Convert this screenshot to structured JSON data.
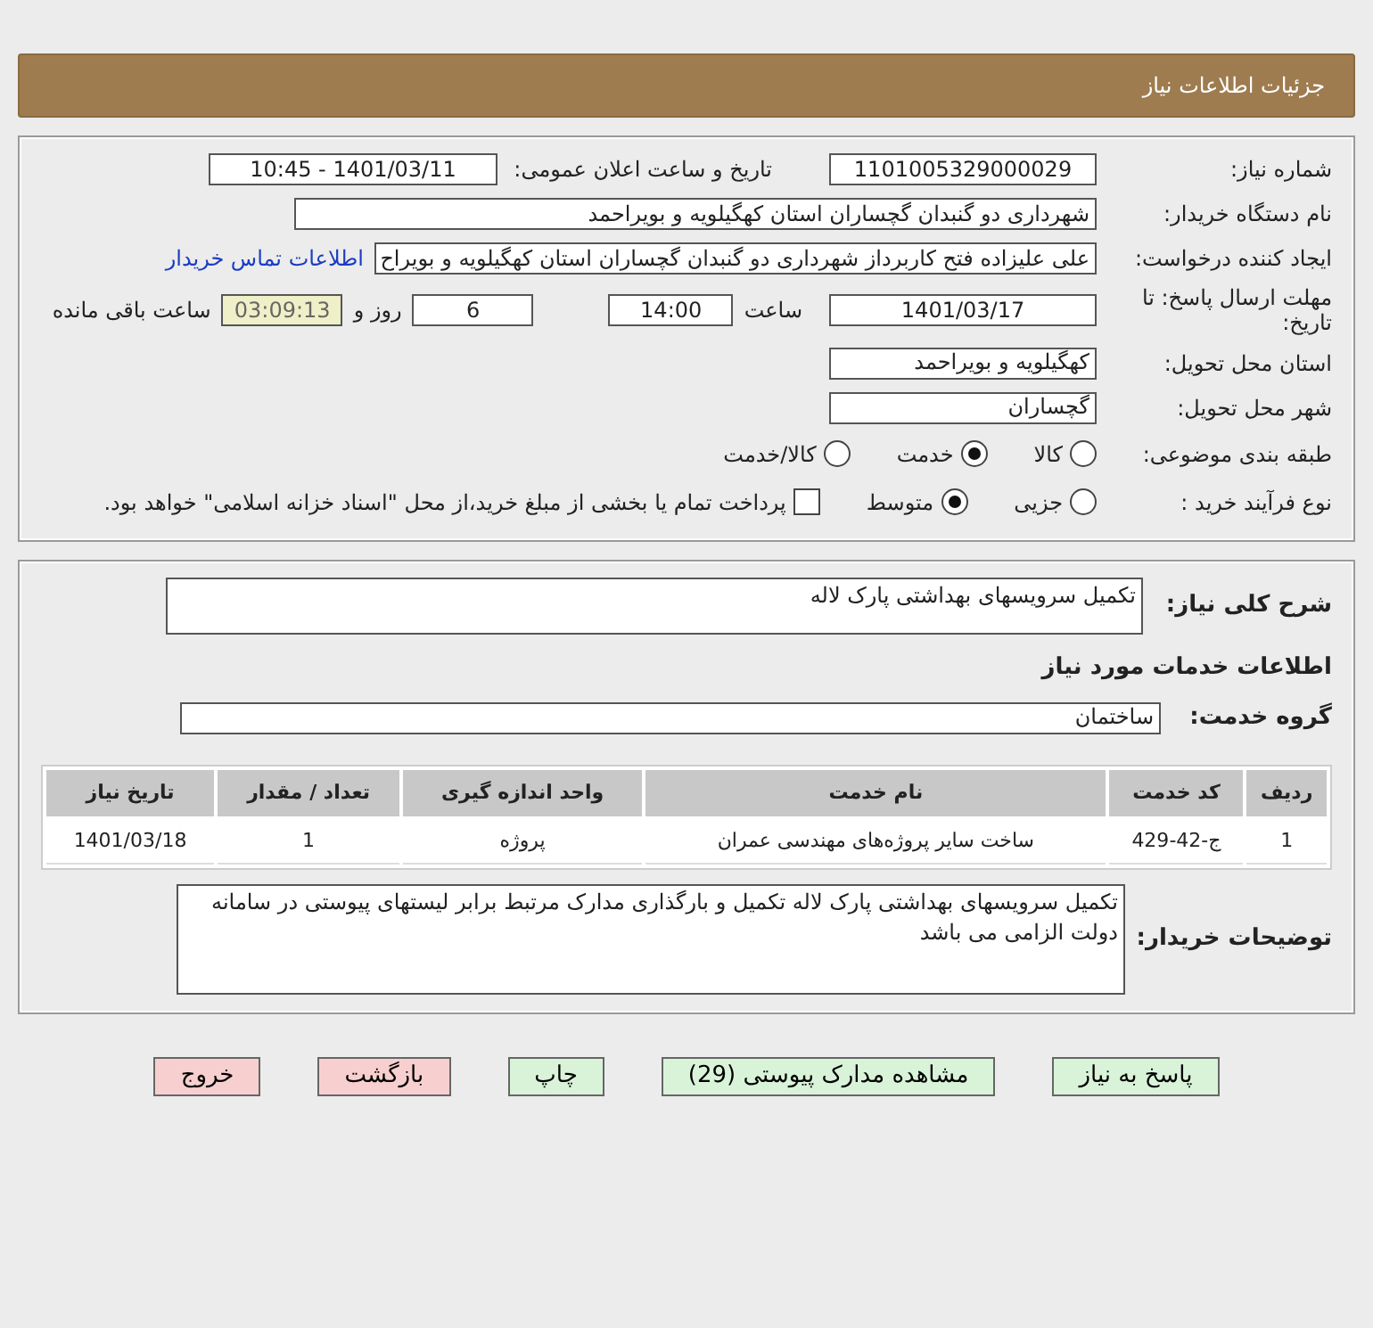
{
  "header": {
    "title": "جزئیات اطلاعات نیاز"
  },
  "need_number": {
    "label": "شماره نیاز:",
    "value": "1101005329000029"
  },
  "announce": {
    "label": "تاریخ و ساعت اعلان عمومی:",
    "value": "1401/03/11 - 10:45"
  },
  "buyer_org": {
    "label": "نام دستگاه خریدار:",
    "value": "شهرداری دو گنبدان گچساران استان کهگیلویه و بویراحمد"
  },
  "requester": {
    "label": "ایجاد کننده درخواست:",
    "value": "علی علیزاده فتح کاربرداز شهرداری دو گنبدان گچساران استان کهگیلویه و بویراح",
    "link": "اطلاعات تماس خریدار"
  },
  "deadline": {
    "label": "مهلت ارسال پاسخ: تا تاریخ:",
    "date": "1401/03/17",
    "time_label": "ساعت",
    "time": "14:00",
    "days": "6",
    "days_label": "روز و",
    "remaining": "03:09:13",
    "remaining_label": "ساعت باقی مانده"
  },
  "province": {
    "label": "استان محل تحویل:",
    "value": "کهگیلویه و بویراحمد"
  },
  "city": {
    "label": "شهر محل تحویل:",
    "value": "گچساران"
  },
  "category": {
    "label": "طبقه بندی موضوعی:",
    "options": [
      {
        "label": "کالا",
        "selected": false
      },
      {
        "label": "خدمت",
        "selected": true
      },
      {
        "label": "کالا/خدمت",
        "selected": false
      }
    ]
  },
  "process": {
    "label": "نوع فرآیند خرید :",
    "options": [
      {
        "label": "جزیی",
        "selected": false
      },
      {
        "label": "متوسط",
        "selected": true
      }
    ],
    "payment": {
      "checked": false,
      "text": "پرداخت تمام یا بخشی از مبلغ خرید،از محل \"اسناد خزانه اسلامی\" خواهد بود."
    }
  },
  "description": {
    "label": "شرح کلی نیاز:",
    "value": "تکمیل سرویسهای بهداشتی پارک لاله"
  },
  "services_heading": "اطلاعات خدمات مورد نیاز",
  "service_group": {
    "label": "گروه خدمت:",
    "value": "ساختمان"
  },
  "table": {
    "columns": [
      "ردیف",
      "کد خدمت",
      "نام خدمت",
      "واحد اندازه گیری",
      "تعداد / مقدار",
      "تاریخ نیاز"
    ],
    "rows": [
      [
        "1",
        "ج-42-429",
        "ساخت سایر پروژه‌های مهندسی عمران",
        "پروژه",
        "1",
        "1401/03/18"
      ]
    ]
  },
  "buyer_notes": {
    "label": "توضیحات خریدار:",
    "value": "تکمیل سرویسهای بهداشتی پارک لاله  تکمیل و بارگذاری مدارک مرتبط   برابر لیستهای پیوستی  در سامانه دولت الزامی می باشد"
  },
  "buttons": [
    {
      "label": "پاسخ به نیاز",
      "kind": "green"
    },
    {
      "label": "مشاهده مدارک پیوستی (29)",
      "kind": "green"
    },
    {
      "label": "چاپ",
      "kind": "green"
    },
    {
      "label": "بازگشت",
      "kind": "pink"
    },
    {
      "label": "خروج",
      "kind": "pink"
    }
  ]
}
